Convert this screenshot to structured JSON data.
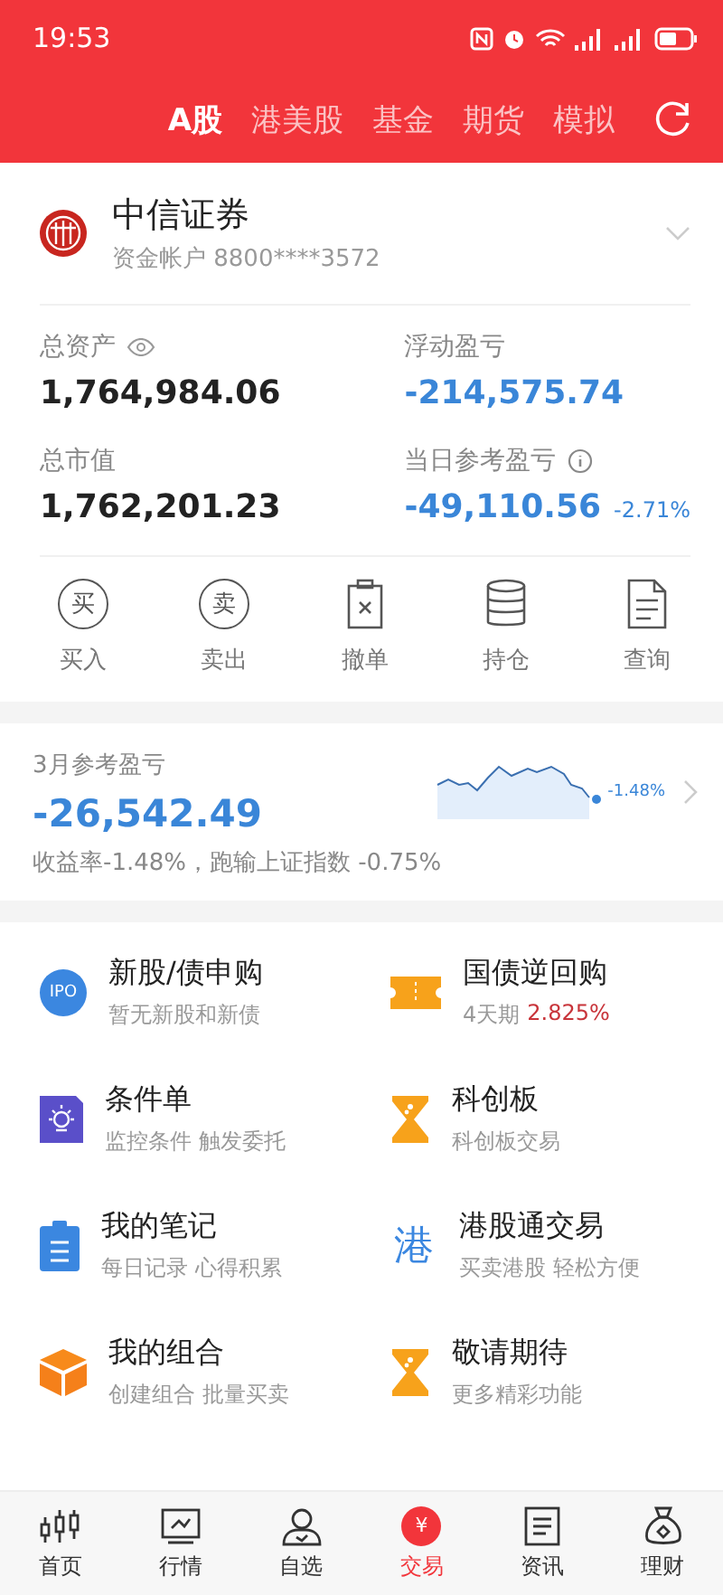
{
  "status_bar": {
    "time": "19:53"
  },
  "market_tabs": [
    {
      "label": "A股",
      "selected": true
    },
    {
      "label": "港美股",
      "selected": false
    },
    {
      "label": "基金",
      "selected": false
    },
    {
      "label": "期货",
      "selected": false
    },
    {
      "label": "模拟",
      "selected": false
    }
  ],
  "account": {
    "broker": "中信证券",
    "account_label": "资金帐户 8800****3572",
    "stats": [
      {
        "label": "总资产",
        "value": "1,764,984.06",
        "kind": "eye"
      },
      {
        "label": "浮动盈亏",
        "value": "-214,575.74",
        "kind": "loss"
      },
      {
        "label": "总市值",
        "value": "1,762,201.23",
        "kind": "plain"
      },
      {
        "label": "当日参考盈亏",
        "value": "-49,110.56",
        "percent": "-2.71%",
        "kind": "info"
      }
    ],
    "actions": [
      {
        "label": "买入",
        "kind": "circle",
        "glyph": "买"
      },
      {
        "label": "卖出",
        "kind": "circle",
        "glyph": "卖"
      },
      {
        "label": "撤单",
        "kind": "cancel"
      },
      {
        "label": "持仓",
        "kind": "stack"
      },
      {
        "label": "查询",
        "kind": "doc"
      }
    ]
  },
  "monthly": {
    "title": "3月参考盈亏",
    "value": "-26,542.49",
    "summary": "收益率-1.48%，跑输上证指数 -0.75%",
    "sparkline_label": "-1.48%"
  },
  "features": [
    {
      "title": "新股/债申购",
      "subtitle": "暂无新股和新债",
      "kind": "ipo",
      "glyph": "IPO"
    },
    {
      "title": "国债逆回购",
      "subtitle": "4天期",
      "rate": "2.825%",
      "kind": "ticket"
    },
    {
      "title": "条件单",
      "subtitle": "监控条件 触发委托",
      "kind": "bulb"
    },
    {
      "title": "科创板",
      "subtitle": "科创板交易",
      "kind": "hourglass"
    },
    {
      "title": "我的笔记",
      "subtitle": "每日记录 心得积累",
      "kind": "clipboard"
    },
    {
      "title": "港股通交易",
      "subtitle": "买卖港股 轻松方便",
      "kind": "char",
      "glyph": "港"
    },
    {
      "title": "我的组合",
      "subtitle": "创建组合 批量买卖",
      "kind": "box"
    },
    {
      "title": "敬请期待",
      "subtitle": "更多精彩功能",
      "kind": "hourglass"
    }
  ],
  "bottom_nav": [
    {
      "label": "首页",
      "kind": "candles",
      "selected": false
    },
    {
      "label": "行情",
      "kind": "chart",
      "selected": false
    },
    {
      "label": "自选",
      "kind": "person",
      "selected": false
    },
    {
      "label": "交易",
      "kind": "yen",
      "glyph": "¥",
      "selected": true
    },
    {
      "label": "资讯",
      "kind": "news",
      "selected": false
    },
    {
      "label": "理财",
      "kind": "bag",
      "selected": false
    }
  ]
}
